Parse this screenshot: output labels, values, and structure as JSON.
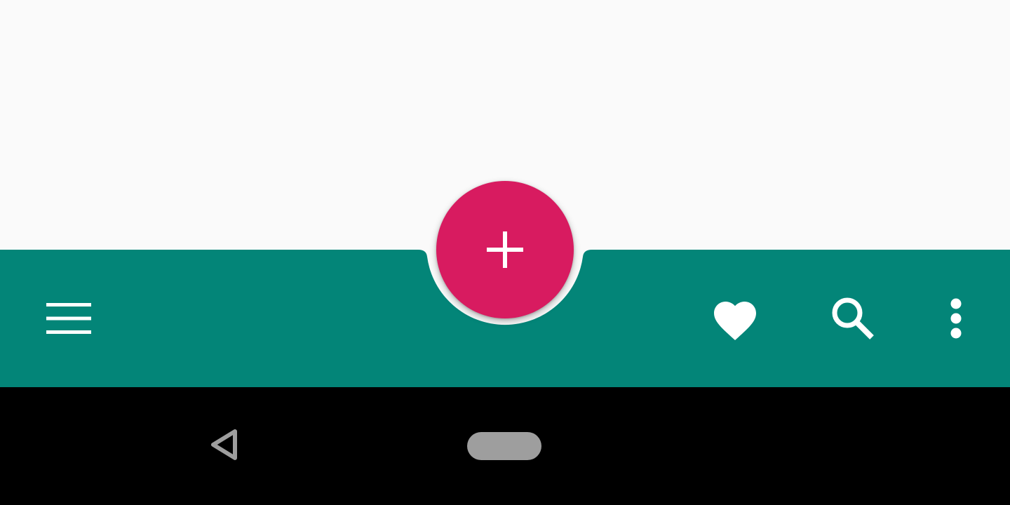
{
  "colors": {
    "background": "#fafafa",
    "app_bar": "#038578",
    "fab": "#d81b60",
    "icon": "#ffffff",
    "nav_bar": "#000000",
    "nav_icon": "#9e9e9e"
  },
  "bottom_app_bar": {
    "navigation_icon": "menu-icon",
    "actions": [
      "favorite-icon",
      "search-icon",
      "more-vert-icon"
    ]
  },
  "fab": {
    "icon": "add-icon"
  },
  "system_nav": {
    "back_icon": "back-triangle-icon",
    "home_icon": "home-pill-icon"
  }
}
